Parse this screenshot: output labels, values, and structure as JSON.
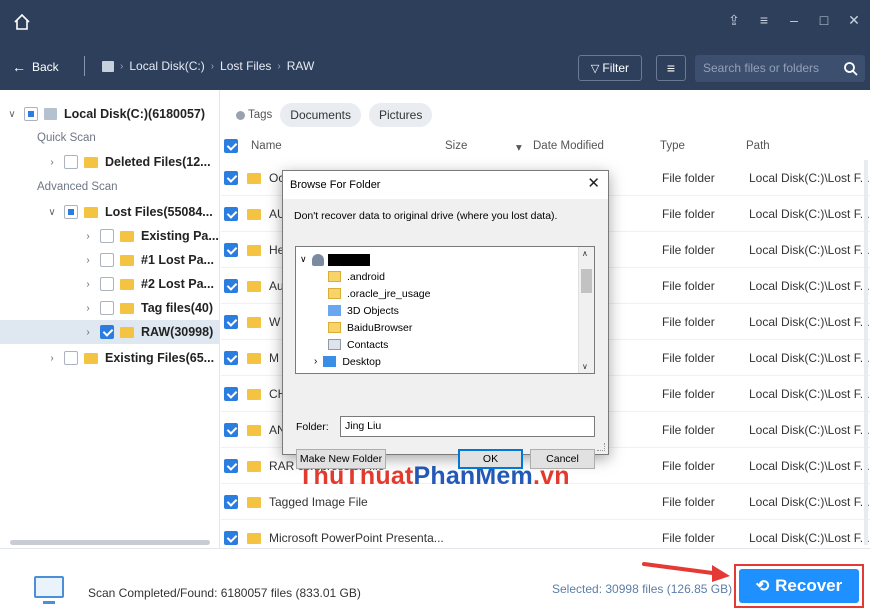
{
  "nav": {
    "back_label": "Back",
    "breadcrumbs": [
      "Local Disk(C:)",
      "Lost Files",
      "RAW"
    ],
    "filter_label": "Filter",
    "search_placeholder": "Search files or folders"
  },
  "tree": {
    "root_label": "Local Disk(C:)(6180057)",
    "quick_scan_label": "Quick Scan",
    "advanced_scan_label": "Advanced Scan",
    "deleted_files": "Deleted Files(12...",
    "lost_files": "Lost Files(55084...",
    "existing_pa": "Existing Pa...",
    "lost_pa_1": "#1 Lost Pa...",
    "lost_pa_2": "#2 Lost Pa...",
    "tag_files": "Tag files(40)",
    "raw": "RAW(30998)",
    "existing_files": "Existing Files(65..."
  },
  "tags": {
    "label": "Tags",
    "items": [
      "Documents",
      "Pictures"
    ]
  },
  "table": {
    "headers": {
      "name": "Name",
      "size": "Size",
      "date": "Date Modified",
      "type": "Type",
      "path": "Path"
    },
    "rows": [
      {
        "name": "Oc",
        "type": "File folder",
        "path": "Local Disk(C:)\\Lost F..."
      },
      {
        "name": "AU",
        "type": "File folder",
        "path": "Local Disk(C:)\\Lost F..."
      },
      {
        "name": "He",
        "type": "File folder",
        "path": "Local Disk(C:)\\Lost F..."
      },
      {
        "name": "Au",
        "type": "File folder",
        "path": "Local Disk(C:)\\Lost F..."
      },
      {
        "name": "W",
        "type": "File folder",
        "path": "Local Disk(C:)\\Lost F..."
      },
      {
        "name": "M",
        "type": "File folder",
        "path": "Local Disk(C:)\\Lost F..."
      },
      {
        "name": "CH",
        "type": "File folder",
        "path": "Local Disk(C:)\\Lost F..."
      },
      {
        "name": "AN",
        "type": "File folder",
        "path": "Local Disk(C:)\\Lost F..."
      },
      {
        "name": "RAR compression file",
        "type": "File folder",
        "path": "Local Disk(C:)\\Lost F..."
      },
      {
        "name": "Tagged Image File",
        "type": "File folder",
        "path": "Local Disk(C:)\\Lost F..."
      },
      {
        "name": "Microsoft PowerPoint Presenta...",
        "type": "File folder",
        "path": "Local Disk(C:)\\Lost F..."
      }
    ]
  },
  "dialog": {
    "title": "Browse For Folder",
    "message": "Don't recover data to original drive (where you lost data).",
    "tree_items": [
      ".android",
      ".oracle_jre_usage",
      "3D Objects",
      "BaiduBrowser",
      "Contacts",
      "Desktop"
    ],
    "folder_label": "Folder:",
    "folder_value": "Jing Liu",
    "make_new_folder": "Make New Folder",
    "ok": "OK",
    "cancel": "Cancel"
  },
  "watermark": {
    "part1": "ThuThuat",
    "part2": "PhanMem",
    "part3": ".vn"
  },
  "bottom": {
    "status": "Scan Completed/Found: 6180057 files (833.01 GB)",
    "selected": "Selected: 30998 files (126.85 GB)",
    "recover_label": "Recover"
  },
  "colors": {
    "header_bg": "#2e3f5c",
    "accent": "#1e90ff",
    "highlight_red": "#e53935",
    "folder": "#f5c342"
  }
}
